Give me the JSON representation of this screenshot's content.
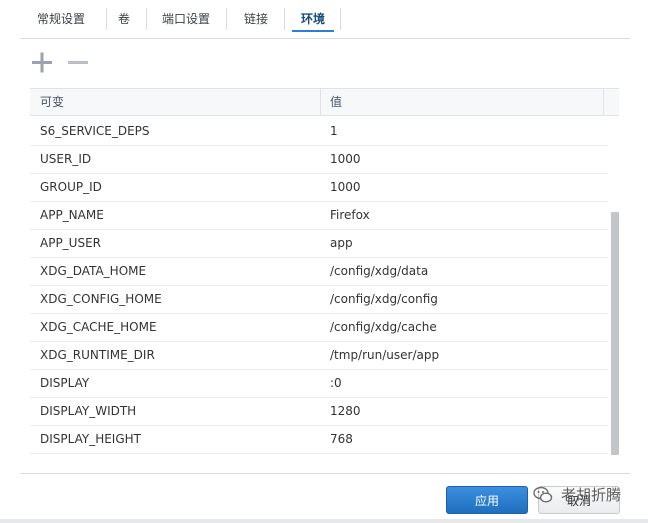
{
  "tabs": {
    "general": "常规设置",
    "volume": "卷",
    "port": "端口设置",
    "links": "链接",
    "env": "环境"
  },
  "table": {
    "header_var": "可变",
    "header_val": "值",
    "rows": [
      {
        "var": "S6_SERVICE_DEPS",
        "val": "1"
      },
      {
        "var": "USER_ID",
        "val": "1000"
      },
      {
        "var": "GROUP_ID",
        "val": "1000"
      },
      {
        "var": "APP_NAME",
        "val": "Firefox"
      },
      {
        "var": "APP_USER",
        "val": "app"
      },
      {
        "var": "XDG_DATA_HOME",
        "val": "/config/xdg/data"
      },
      {
        "var": "XDG_CONFIG_HOME",
        "val": "/config/xdg/config"
      },
      {
        "var": "XDG_CACHE_HOME",
        "val": "/config/xdg/cache"
      },
      {
        "var": "XDG_RUNTIME_DIR",
        "val": "/tmp/run/user/app"
      },
      {
        "var": "DISPLAY",
        "val": ":0"
      },
      {
        "var": "DISPLAY_WIDTH",
        "val": "1280"
      },
      {
        "var": "DISPLAY_HEIGHT",
        "val": "768"
      }
    ]
  },
  "toolbar": {
    "add_icon": "plus-icon",
    "remove_icon": "minus-icon"
  },
  "footer": {
    "apply_label": "应用",
    "cancel_label": "取消"
  },
  "watermark": {
    "text": "老胡折腾"
  },
  "colors": {
    "accent": "#2d7fd3",
    "apply_bg": "#2a7fd0"
  }
}
